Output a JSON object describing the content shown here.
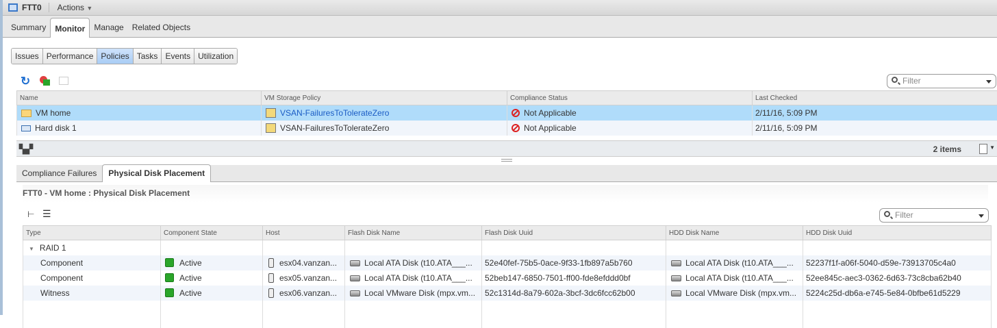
{
  "header": {
    "title": "FTT0",
    "actions": "Actions"
  },
  "main_tabs": [
    "Summary",
    "Monitor",
    "Manage",
    "Related Objects"
  ],
  "sub_tabs": [
    "Issues",
    "Performance",
    "Policies",
    "Tasks",
    "Events",
    "Utilization"
  ],
  "filter_placeholder": "Filter",
  "policies_table": {
    "columns": [
      "Name",
      "VM Storage Policy",
      "Compliance Status",
      "Last Checked"
    ],
    "rows": [
      {
        "name": "VM home",
        "policy": "VSAN-FailuresToTolerateZero",
        "status": "Not Applicable",
        "checked": "2/11/16, 5:09 PM"
      },
      {
        "name": "Hard disk 1",
        "policy": "VSAN-FailuresToTolerateZero",
        "status": "Not Applicable",
        "checked": "2/11/16, 5:09 PM"
      }
    ],
    "count": "2 items"
  },
  "bottom_tabs": [
    "Compliance Failures",
    "Physical Disk Placement"
  ],
  "placement_title": "FTT0 - VM home : Physical Disk Placement",
  "placement_table": {
    "columns": [
      "Type",
      "Component State",
      "Host",
      "Flash Disk Name",
      "Flash Disk Uuid",
      "HDD Disk Name",
      "HDD Disk Uuid"
    ],
    "group": "RAID 1",
    "rows": [
      {
        "type": "Component",
        "state": "Active",
        "host": "esx04.vanzan...",
        "flash": "Local ATA Disk (t10.ATA___...",
        "flash_uuid": "52e40fef-75b5-0ace-9f33-1fb897a5b760",
        "hdd": "Local ATA Disk (t10.ATA___...",
        "hdd_uuid": "52237f1f-a06f-5040-d59e-73913705c4a0"
      },
      {
        "type": "Component",
        "state": "Active",
        "host": "esx05.vanzan...",
        "flash": "Local ATA Disk (t10.ATA___...",
        "flash_uuid": "52beb147-6850-7501-ff00-fde8efddd0bf",
        "hdd": "Local ATA Disk (t10.ATA___...",
        "hdd_uuid": "52ee845c-aec3-0362-6d63-73c8cba62b40"
      },
      {
        "type": "Witness",
        "state": "Active",
        "host": "esx06.vanzan...",
        "flash": "Local VMware Disk (mpx.vm...",
        "flash_uuid": "52c1314d-8a79-602a-3bcf-3dc6fcc62b00",
        "hdd": "Local VMware Disk (mpx.vm...",
        "hdd_uuid": "5224c25d-db6a-e745-5e84-0bfbe61d5229"
      }
    ]
  }
}
